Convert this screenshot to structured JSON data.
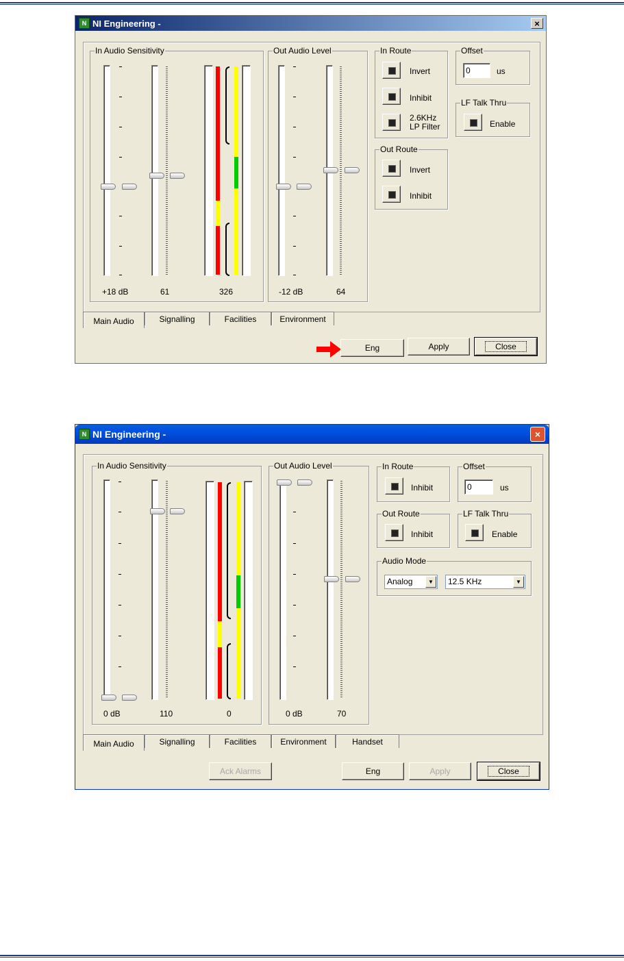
{
  "window1": {
    "title": "NI Engineering -",
    "close_glyph": "×",
    "in_audio_sensitivity": {
      "label": "In Audio Sensitivity",
      "slider1_value": "+18 dB",
      "slider2_value": "61",
      "meter_value": "326"
    },
    "out_audio_level": {
      "label": "Out Audio Level",
      "slider1_value": "-12 dB",
      "slider2_value": "64"
    },
    "in_route": {
      "label": "In Route",
      "invert": "Invert",
      "inhibit": "Inhibit",
      "filter_line1": "2.6KHz",
      "filter_line2": "LP Filter"
    },
    "out_route": {
      "label": "Out Route",
      "invert": "Invert",
      "inhibit": "Inhibit"
    },
    "offset": {
      "label": "Offset",
      "value": "0",
      "unit": "us"
    },
    "lf_talk_thru": {
      "label": "LF Talk Thru",
      "enable": "Enable"
    },
    "tabs": [
      "Main Audio",
      "Signalling",
      "Facilities",
      "Environment"
    ],
    "buttons": {
      "eng": "Eng",
      "apply": "Apply",
      "close": "Close"
    }
  },
  "window2": {
    "title": "NI Engineering -",
    "close_glyph": "×",
    "in_audio_sensitivity": {
      "label": "In Audio Sensitivity",
      "slider1_value": "0 dB",
      "slider2_value": "110",
      "meter_value": "0"
    },
    "out_audio_level": {
      "label": "Out Audio Level",
      "slider1_value": "0 dB",
      "slider2_value": "70"
    },
    "in_route": {
      "label": "In Route",
      "inhibit": "Inhibit"
    },
    "offset": {
      "label": "Offset",
      "value": "0",
      "unit": "us"
    },
    "out_route": {
      "label": "Out Route",
      "inhibit": "Inhibit"
    },
    "lf_talk_thru": {
      "label": "LF Talk Thru",
      "enable": "Enable"
    },
    "audio_mode": {
      "label": "Audio Mode",
      "mode": "Analog",
      "bandwidth": "12.5 KHz"
    },
    "tabs": [
      "Main Audio",
      "Signalling",
      "Facilities",
      "Environment",
      "Handset"
    ],
    "buttons": {
      "ack_alarms": "Ack Alarms",
      "eng": "Eng",
      "apply": "Apply",
      "close": "Close"
    }
  },
  "colors": {
    "meter_red": "#ff0000",
    "meter_yellow": "#ffff00",
    "meter_green": "#00cc00",
    "arrow": "#ff0000"
  }
}
